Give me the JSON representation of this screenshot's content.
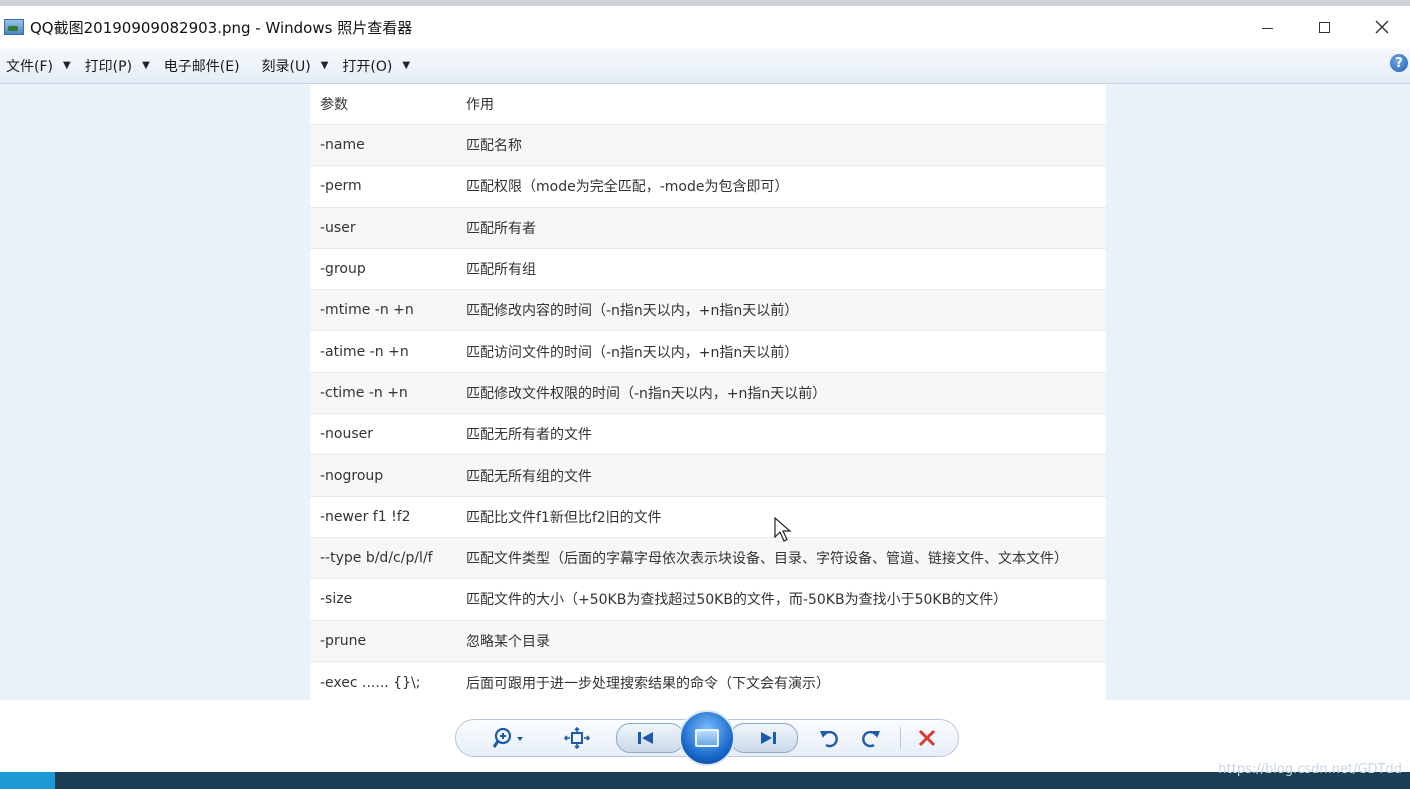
{
  "window": {
    "title": "QQ截图20190909082903.png - Windows 照片查看器"
  },
  "menu": {
    "items": [
      {
        "label": "文件(F)",
        "has_dropdown": true
      },
      {
        "label": "打印(P)",
        "has_dropdown": true
      },
      {
        "label": "电子邮件(E)",
        "has_dropdown": false
      },
      {
        "label": "刻录(U)",
        "has_dropdown": true
      },
      {
        "label": "打开(O)",
        "has_dropdown": true
      }
    ],
    "help_glyph": "?"
  },
  "table": {
    "headers": [
      "参数",
      "作用"
    ],
    "rows": [
      [
        "-name",
        "匹配名称"
      ],
      [
        "-perm",
        "匹配权限（mode为完全匹配，-mode为包含即可）"
      ],
      [
        "-user",
        "匹配所有者"
      ],
      [
        "-group",
        "匹配所有组"
      ],
      [
        "-mtime -n +n",
        "匹配修改内容的时间（-n指n天以内，+n指n天以前）"
      ],
      [
        "-atime -n +n",
        "匹配访问文件的时间（-n指n天以内，+n指n天以前）"
      ],
      [
        "-ctime -n +n",
        "匹配修改文件权限的时间（-n指n天以内，+n指n天以前）"
      ],
      [
        "-nouser",
        "匹配无所有者的文件"
      ],
      [
        "-nogroup",
        "匹配无所有组的文件"
      ],
      [
        "-newer f1 !f2",
        "匹配比文件f1新但比f2旧的文件"
      ],
      [
        "--type b/d/c/p/l/f",
        "匹配文件类型（后面的字幕字母依次表示块设备、目录、字符设备、管道、链接文件、文本文件）"
      ],
      [
        "-size",
        "匹配文件的大小（+50KB为查找超过50KB的文件，而-50KB为查找小于50KB的文件）"
      ],
      [
        "-prune",
        "忽略某个目录"
      ],
      [
        "-exec ...... {}\\;",
        "后面可跟用于进一步处理搜索结果的命令（下文会有演示）"
      ]
    ]
  },
  "toolbar": {
    "icons": [
      "zoom-icon",
      "fit-window-icon",
      "previous-icon",
      "slideshow-icon",
      "next-icon",
      "rotate-left-icon",
      "rotate-right-icon",
      "delete-icon"
    ],
    "accent": "#1e5aa8",
    "delete_color": "#d83a2e"
  },
  "watermark": "https://blog.csdn.net/GDTdd"
}
